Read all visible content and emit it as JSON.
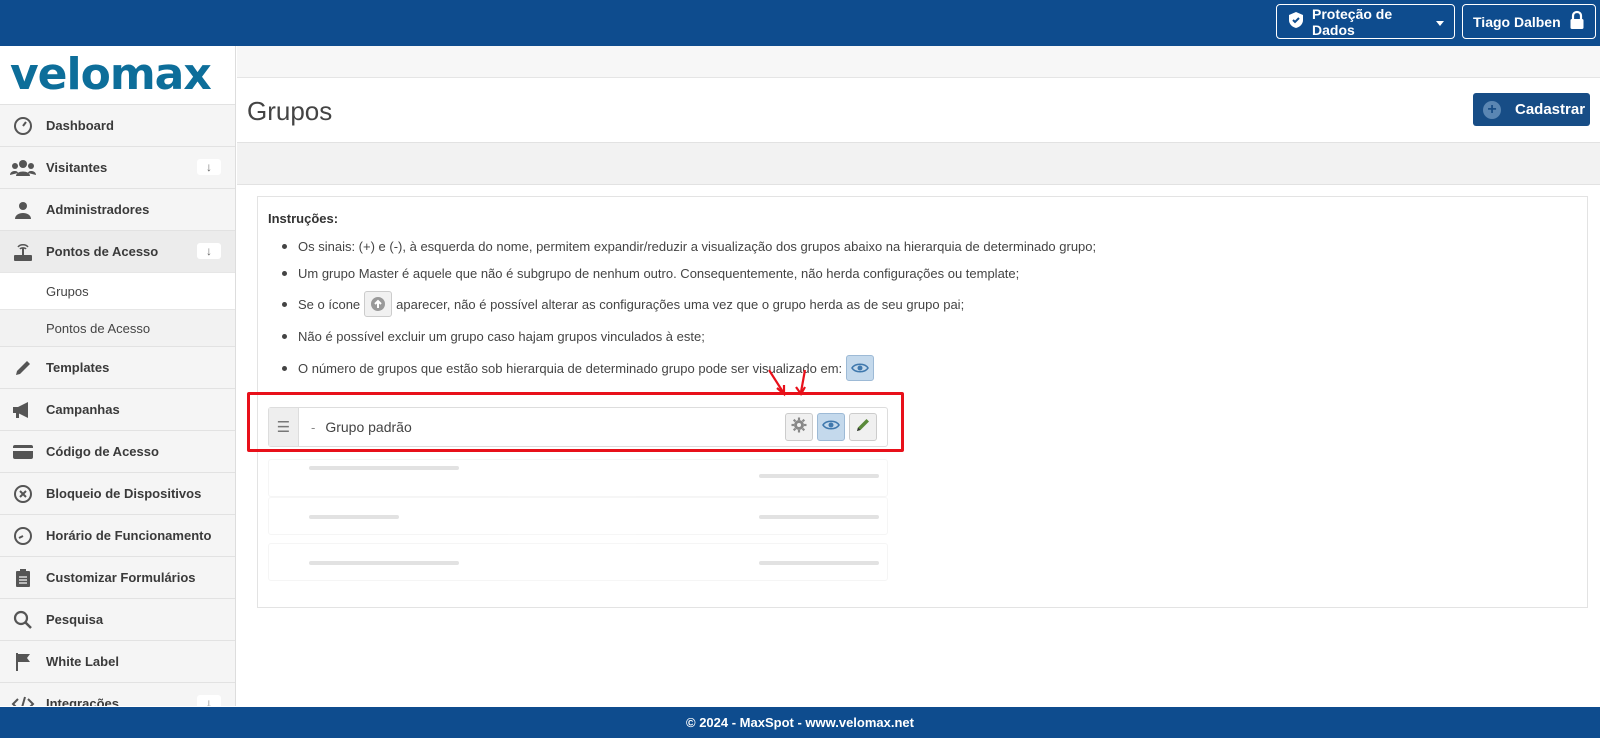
{
  "topbar": {
    "lgpd_label": "Proteção de Dados",
    "user_label": "Tiago Dalben"
  },
  "brand": {
    "logo_text": "velomax"
  },
  "sidebar": {
    "items": [
      {
        "label": "Dashboard",
        "icon": "dashboard-icon"
      },
      {
        "label": "Visitantes",
        "icon": "users-icon",
        "arrow": "↓"
      },
      {
        "label": "Administradores",
        "icon": "user-icon"
      },
      {
        "label": "Pontos de Acesso",
        "icon": "router-icon",
        "arrow": "↓"
      },
      {
        "label": "Templates",
        "icon": "pencil-icon"
      },
      {
        "label": "Campanhas",
        "icon": "megaphone-icon"
      },
      {
        "label": "Código de Acesso",
        "icon": "card-icon"
      },
      {
        "label": "Bloqueio de Dispositivos",
        "icon": "block-icon"
      },
      {
        "label": "Horário de Funcionamento",
        "icon": "clock-icon"
      },
      {
        "label": "Customizar Formulários",
        "icon": "clipboard-icon"
      },
      {
        "label": "Pesquisa",
        "icon": "search-icon"
      },
      {
        "label": "White Label",
        "icon": "flag-icon"
      },
      {
        "label": "Integrações",
        "icon": "code-icon",
        "arrow": "↓"
      }
    ],
    "subitems": [
      {
        "label": "Grupos"
      },
      {
        "label": "Pontos de Acesso"
      }
    ]
  },
  "main": {
    "title": "Grupos",
    "cadastrar_label": "Cadastrar",
    "instructions_title": "Instruções:",
    "instructions": [
      "Os sinais: (+) e (-), à esquerda do nome, permitem expandir/reduzir a visualização dos grupos abaixo na hierarquia de determinado grupo;",
      "Um grupo Master é aquele que não é subgrupo de nenhum outro. Consequentemente, não herda configurações ou template;",
      "Se o ícone",
      "aparecer, não é possível alterar as configurações uma vez que o grupo herda as de seu grupo pai;",
      "Não é possível excluir um grupo caso hajam grupos vinculados à este;",
      "O número de grupos que estão sob hierarquia de determinado grupo pode ser visualizado em:"
    ],
    "group_row": {
      "dash": "-",
      "name": "Grupo padrão"
    }
  },
  "footer": {
    "text": "© 2024 - MaxSpot - www.velomax.net"
  },
  "colors": {
    "topbar": "#0e4c8e",
    "button": "#174d86",
    "highlight": "#e8101a"
  }
}
